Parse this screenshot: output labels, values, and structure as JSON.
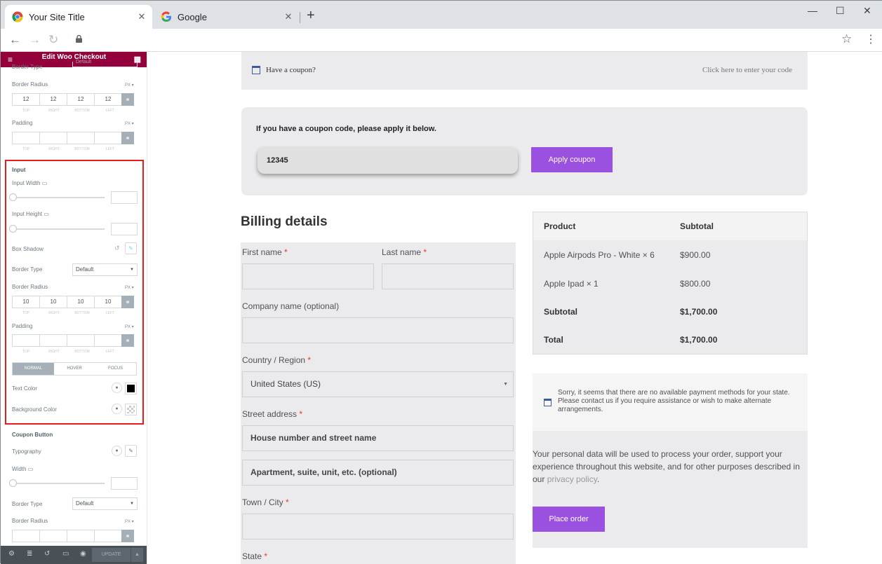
{
  "browser": {
    "tabs": [
      {
        "title": "Your Site Title",
        "active": true
      },
      {
        "title": "Google",
        "active": false
      }
    ],
    "close_glyph": "✕",
    "new_tab_glyph": "+",
    "icons": {
      "back": "←",
      "forward": "→",
      "reload": "↻",
      "star": "☆",
      "menu": "⋮",
      "minimize": "—",
      "maximize": "☐",
      "close": "✕"
    }
  },
  "editor": {
    "title": "Edit Woo Checkout",
    "top_border_type_value": "Default",
    "border_radius_label": "Border Radius",
    "unit": "PX ▾",
    "radius_values_top": [
      "12",
      "12",
      "12",
      "12"
    ],
    "dim_labels": [
      "TOP",
      "RIGHT",
      "BOTTOM",
      "LEFT"
    ],
    "padding_label": "Padding",
    "input_section": "Input",
    "input_width_label": "Input Width",
    "input_height_label": "Input Height",
    "box_shadow_label": "Box Shadow",
    "border_type_label": "Border Type",
    "border_type_value": "Default",
    "radius_values_input": [
      "10",
      "10",
      "10",
      "10"
    ],
    "states": [
      "NORMAL",
      "HOVER",
      "FOCUS"
    ],
    "text_color_label": "Text Color",
    "bg_color_label": "Background Color",
    "coupon_button_section": "Coupon Button",
    "typography_label": "Typography",
    "width_label": "Width",
    "update_label": "UPDATE",
    "accent": "#93003c"
  },
  "checkout": {
    "coupon_notice": "Have a coupon?",
    "coupon_link": "Click here to enter your code",
    "coupon_prompt": "If you have a coupon code, please apply it below.",
    "coupon_value": "12345",
    "apply_button": "Apply coupon",
    "billing_heading": "Billing details",
    "required_mark": "*",
    "fields": {
      "first_name": "First name",
      "last_name": "Last name",
      "company": "Company name (optional)",
      "country": "Country / Region",
      "country_value": "United States (US)",
      "street": "Street address",
      "street_placeholder_1": "House number and street name",
      "street_placeholder_2": "Apartment, suite, unit, etc. (optional)",
      "town": "Town / City",
      "state": "State"
    },
    "order": {
      "headers": [
        "Product",
        "Subtotal"
      ],
      "items": [
        {
          "name": "Apple Airpods Pro - White  × 6",
          "price": "$900.00"
        },
        {
          "name": "Apple Ipad  × 1",
          "price": "$800.00"
        }
      ],
      "subtotal_label": "Subtotal",
      "subtotal_value": "$1,700.00",
      "total_label": "Total",
      "total_value": "$1,700.00"
    },
    "payment_notice": "Sorry, it seems that there are no available payment methods for your state. Please contact us if you require assistance or wish to make alternate arrangements.",
    "privacy_text": "Your personal data will be used to process your order, support your experience throughout this website, and for other purposes described in our",
    "privacy_link": "privacy policy",
    "privacy_end": ".",
    "place_order": "Place order",
    "accent": "#9b51e0"
  }
}
